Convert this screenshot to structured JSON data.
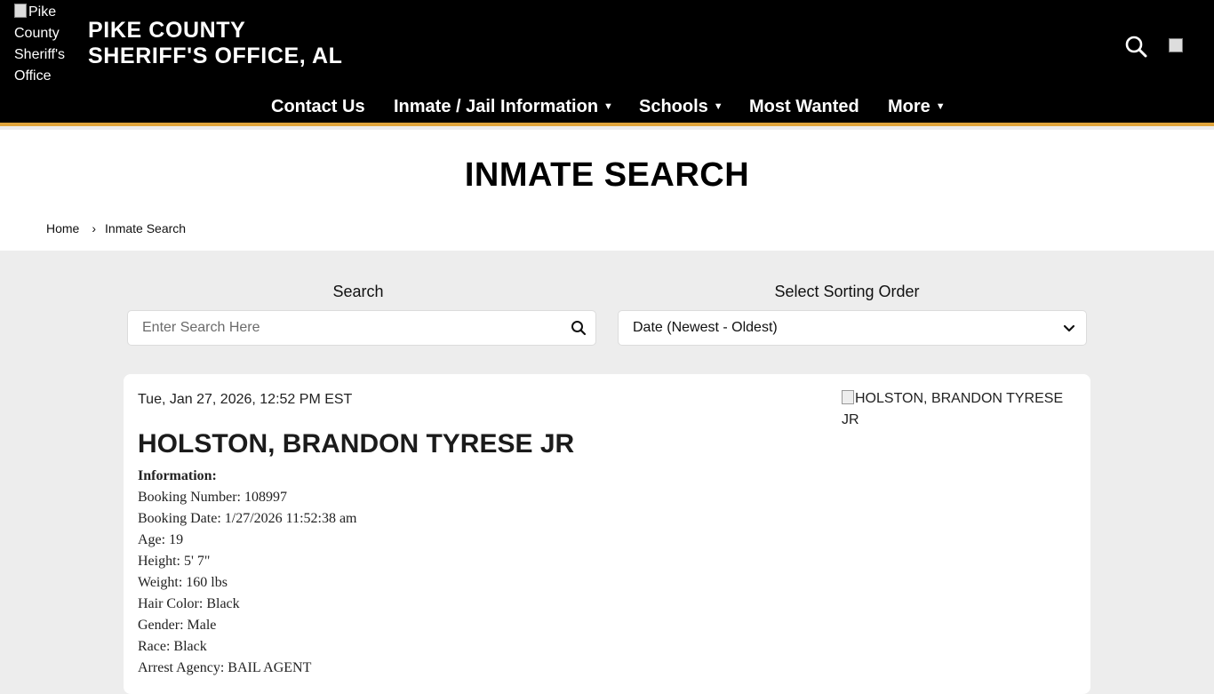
{
  "header": {
    "logo_alt": "Pike County Sheriff's Office",
    "title_line1": "PIKE COUNTY",
    "title_line2": "SHERIFF'S OFFICE, AL"
  },
  "nav": [
    {
      "label": "Contact Us",
      "has_caret": false
    },
    {
      "label": "Inmate / Jail Information",
      "has_caret": true
    },
    {
      "label": "Schools",
      "has_caret": true
    },
    {
      "label": "Most Wanted",
      "has_caret": false
    },
    {
      "label": "More",
      "has_caret": true
    }
  ],
  "page": {
    "title": "INMATE SEARCH",
    "breadcrumb": [
      "Home",
      "Inmate Search"
    ]
  },
  "search": {
    "label": "Search",
    "placeholder": "Enter Search Here",
    "value": ""
  },
  "sort": {
    "label": "Select Sorting Order",
    "selected": "Date (Newest - Oldest)"
  },
  "inmate": {
    "datetime": "Tue, Jan 27, 2026, 12:52 PM EST",
    "name": "HOLSTON, BRANDON TYRESE JR",
    "photo_alt": "HOLSTON, BRANDON TYRESE JR",
    "info_heading": "Information:",
    "fields": [
      "Booking Number: 108997",
      "Booking Date: 1/27/2026 11:52:38 am",
      "Age: 19",
      "Height: 5' 7\"",
      "Weight: 160 lbs",
      "Hair Color: Black",
      "Gender: Male",
      "Race: Black",
      "Arrest Agency: BAIL AGENT"
    ]
  },
  "icons": {
    "search": "search-icon",
    "dropdown": "chevron-down-icon",
    "caret": "caret-down-icon"
  },
  "colors": {
    "header_bg": "#000000",
    "accent": "#e0a43a",
    "page_bg": "#ededed"
  }
}
